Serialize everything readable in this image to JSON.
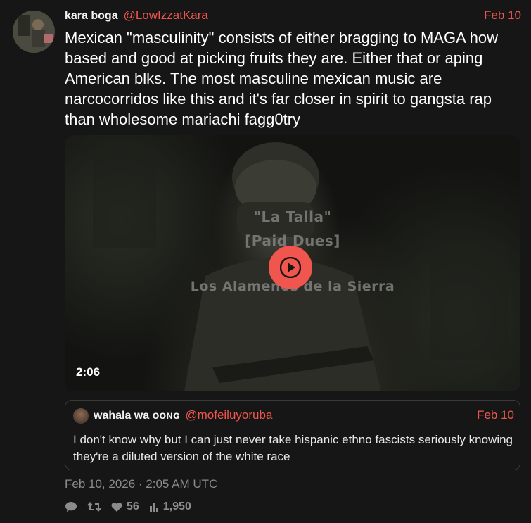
{
  "tweet": {
    "display_name": "kara boga",
    "handle": "@LowIzzatKara",
    "date": "Feb 10",
    "text": "Mexican \"masculinity\" consists of either bragging to MAGA how based and good at picking fruits they are. Either that or aping American blks. The most masculine mexican music are narcocorridos like this and it's far closer in spirit to gangsta rap than wholesome mariachi fagg0try"
  },
  "media": {
    "overlay_title": "\"La Talla\"",
    "overlay_subtitle": "[Paid Dues]",
    "overlay_artist": "Los Alamenos de la Sierra",
    "duration": "2:06",
    "play_icon": "play-icon",
    "accent_color": "#f0564d"
  },
  "quote": {
    "display_name": "wahala wa ooɴɢ",
    "handle": "@mofeiluyoruba",
    "date": "Feb 10",
    "text": "I don't know why but I can just never take hispanic ethno fascists seriously knowing they're a diluted version of the white race"
  },
  "meta": {
    "timestamp": "Feb 10, 2026 · 2:05 AM UTC"
  },
  "stats": {
    "reply_icon": "reply-icon",
    "retweet_icon": "retweet-icon",
    "like_icon": "heart-icon",
    "likes": "56",
    "views_icon": "views-icon",
    "views": "1,950"
  }
}
